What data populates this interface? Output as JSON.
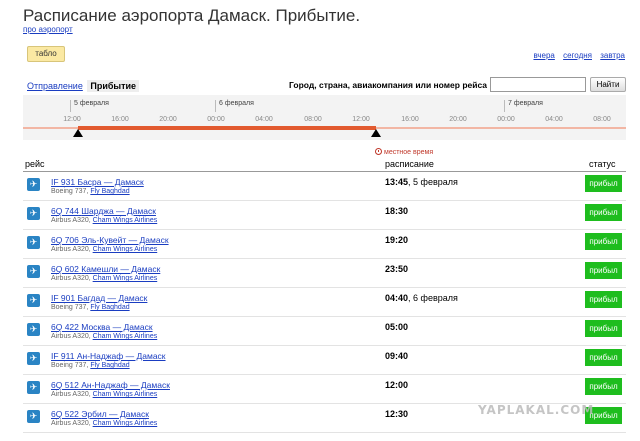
{
  "header": {
    "title": "Расписание аэропорта Дамаск. Прибытие.",
    "about_link": "про аэропорт"
  },
  "view_button": "табло",
  "day_links": [
    "вчера",
    "сегодня",
    "завтра"
  ],
  "tabs": {
    "departure": "Отправление",
    "arrival": "Прибытие"
  },
  "search": {
    "label": "Город, страна, авиакомпания или номер рейса",
    "value": "",
    "button": "Найти"
  },
  "timeline": {
    "days": [
      "5 февраля",
      "6 февраля",
      "7 февраля"
    ],
    "hours": [
      "12:00",
      "16:00",
      "20:00",
      "00:00",
      "04:00",
      "08:00",
      "12:00",
      "16:00",
      "20:00",
      "00:00",
      "04:00",
      "08:00"
    ]
  },
  "local_time_note": "местное время",
  "columns": {
    "flight": "рейс",
    "schedule": "расписание",
    "status": "статус"
  },
  "flights": [
    {
      "code": "IF 931",
      "route": "Басра — Дамаск",
      "aircraft": "Boeing 737",
      "airline": "Fly Baghdad",
      "time": "13:45",
      "date": "5 февраля",
      "status": "прибыл"
    },
    {
      "code": "6Q 744",
      "route": "Шарджа — Дамаск",
      "aircraft": "Airbus A320",
      "airline": "Cham Wings Airlines",
      "time": "18:30",
      "date": "",
      "status": "прибыл"
    },
    {
      "code": "6Q 706",
      "route": "Эль-Кувейт — Дамаск",
      "aircraft": "Airbus A320",
      "airline": "Cham Wings Airlines",
      "time": "19:20",
      "date": "",
      "status": "прибыл"
    },
    {
      "code": "6Q 602",
      "route": "Камешли — Дамаск",
      "aircraft": "Airbus A320",
      "airline": "Cham Wings Airlines",
      "time": "23:50",
      "date": "",
      "status": "прибыл"
    },
    {
      "code": "IF 901",
      "route": "Багдад — Дамаск",
      "aircraft": "Boeing 737",
      "airline": "Fly Baghdad",
      "time": "04:40",
      "date": "6 февраля",
      "status": "прибыл"
    },
    {
      "code": "6Q 422",
      "route": "Москва — Дамаск",
      "aircraft": "Airbus A320",
      "airline": "Cham Wings Airlines",
      "time": "05:00",
      "date": "",
      "status": "прибыл"
    },
    {
      "code": "IF 911",
      "route": "Ан-Наджаф — Дамаск",
      "aircraft": "Boeing 737",
      "airline": "Fly Baghdad",
      "time": "09:40",
      "date": "",
      "status": "прибыл"
    },
    {
      "code": "6Q 512",
      "route": "Ан-Наджаф — Дамаск",
      "aircraft": "Airbus A320",
      "airline": "Cham Wings Airlines",
      "time": "12:00",
      "date": "",
      "status": "прибыл"
    },
    {
      "code": "6Q 522",
      "route": "Эрбил — Дамаск",
      "aircraft": "Airbus A320",
      "airline": "Cham Wings Airlines",
      "time": "12:30",
      "date": "",
      "status": "прибыл"
    }
  ],
  "watermark": "YAPLAKAL.COM",
  "icons": {
    "flight_row": "airplane-icon",
    "local_time": "clock-icon",
    "timeline_marker": "triangle-marker-icon"
  },
  "colors": {
    "link": "#1a3dc1",
    "status_arrived": "#1ebd1e",
    "timeline_range": "#e25a2f",
    "tablo_button": "#fbe9a3"
  }
}
